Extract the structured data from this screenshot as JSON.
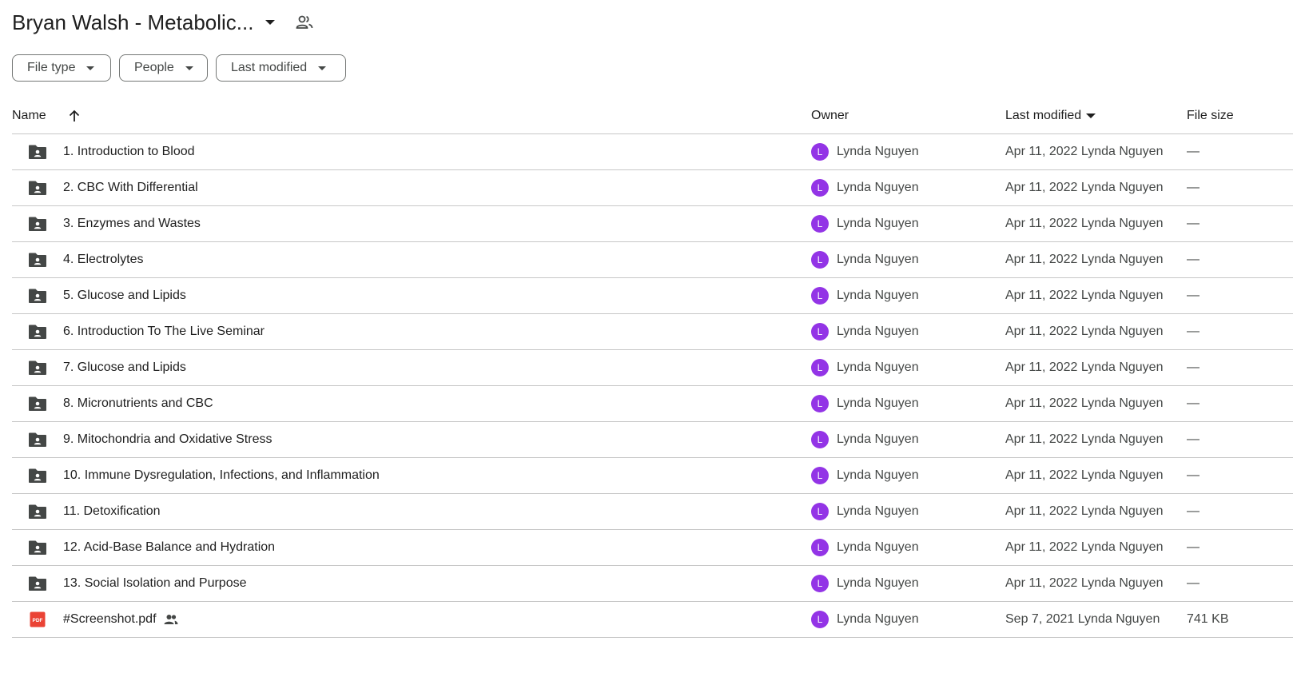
{
  "header": {
    "title": "Bryan Walsh - Metabolic...",
    "title_caret_icon": "arrow-drop-down-icon",
    "shared_icon": "people-icon"
  },
  "filters": [
    {
      "label": "File type"
    },
    {
      "label": "People"
    },
    {
      "label": "Last modified"
    }
  ],
  "table": {
    "columns": {
      "name": "Name",
      "owner": "Owner",
      "last_modified": "Last modified",
      "file_size": "File size"
    },
    "sort_icon": "arrow-upward-icon",
    "rows": [
      {
        "type": "shared-folder",
        "name": "1. Introduction to Blood",
        "owner_initial": "L",
        "owner": "Lynda Nguyen",
        "modified": "Apr 11, 2022 Lynda Nguyen",
        "size": "—"
      },
      {
        "type": "shared-folder",
        "name": "2. CBC With Differential",
        "owner_initial": "L",
        "owner": "Lynda Nguyen",
        "modified": "Apr 11, 2022 Lynda Nguyen",
        "size": "—"
      },
      {
        "type": "shared-folder",
        "name": "3. Enzymes and Wastes",
        "owner_initial": "L",
        "owner": "Lynda Nguyen",
        "modified": "Apr 11, 2022 Lynda Nguyen",
        "size": "—"
      },
      {
        "type": "shared-folder",
        "name": "4. Electrolytes",
        "owner_initial": "L",
        "owner": "Lynda Nguyen",
        "modified": "Apr 11, 2022 Lynda Nguyen",
        "size": "—"
      },
      {
        "type": "shared-folder",
        "name": "5. Glucose and Lipids",
        "owner_initial": "L",
        "owner": "Lynda Nguyen",
        "modified": "Apr 11, 2022 Lynda Nguyen",
        "size": "—"
      },
      {
        "type": "shared-folder",
        "name": "6. Introduction To The Live Seminar",
        "owner_initial": "L",
        "owner": "Lynda Nguyen",
        "modified": "Apr 11, 2022 Lynda Nguyen",
        "size": "—"
      },
      {
        "type": "shared-folder",
        "name": "7. Glucose and Lipids",
        "owner_initial": "L",
        "owner": "Lynda Nguyen",
        "modified": "Apr 11, 2022 Lynda Nguyen",
        "size": "—"
      },
      {
        "type": "shared-folder",
        "name": "8. Micronutrients and CBC",
        "owner_initial": "L",
        "owner": "Lynda Nguyen",
        "modified": "Apr 11, 2022 Lynda Nguyen",
        "size": "—"
      },
      {
        "type": "shared-folder",
        "name": "9. Mitochondria and Oxidative Stress",
        "owner_initial": "L",
        "owner": "Lynda Nguyen",
        "modified": "Apr 11, 2022 Lynda Nguyen",
        "size": "—"
      },
      {
        "type": "shared-folder",
        "name": "10. Immune Dysregulation, Infections, and Inflammation",
        "owner_initial": "L",
        "owner": "Lynda Nguyen",
        "modified": "Apr 11, 2022 Lynda Nguyen",
        "size": "—"
      },
      {
        "type": "shared-folder",
        "name": "11. Detoxification",
        "owner_initial": "L",
        "owner": "Lynda Nguyen",
        "modified": "Apr 11, 2022 Lynda Nguyen",
        "size": "—"
      },
      {
        "type": "shared-folder",
        "name": "12. Acid-Base Balance and Hydration",
        "owner_initial": "L",
        "owner": "Lynda Nguyen",
        "modified": "Apr 11, 2022 Lynda Nguyen",
        "size": "—"
      },
      {
        "type": "shared-folder",
        "name": "13. Social Isolation and Purpose",
        "owner_initial": "L",
        "owner": "Lynda Nguyen",
        "modified": "Apr 11, 2022 Lynda Nguyen",
        "size": "—"
      },
      {
        "type": "pdf",
        "name": "#Screenshot.pdf",
        "shared": true,
        "owner_initial": "L",
        "owner": "Lynda Nguyen",
        "modified": "Sep 7, 2021 Lynda Nguyen",
        "size": "741 KB"
      }
    ]
  },
  "colors": {
    "avatar": "#9334e6",
    "pdf_icon": "#ea4335",
    "folder_icon": "#444746",
    "divider": "#c7c7c7"
  }
}
